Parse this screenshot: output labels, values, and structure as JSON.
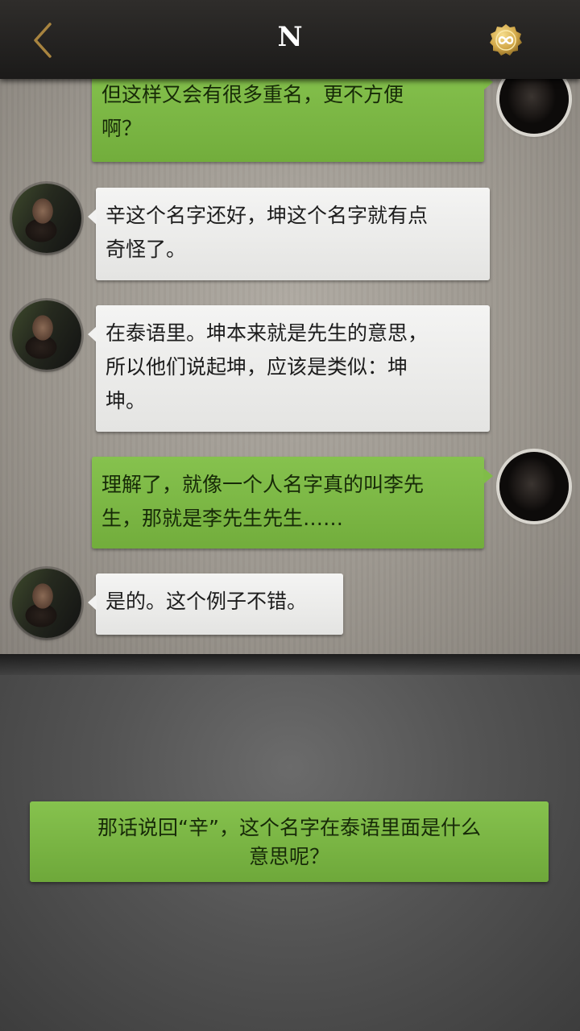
{
  "header": {
    "title": "N",
    "back_icon": "chevron-left-icon",
    "coin_icon": "infinity-coin-icon",
    "accent_color": "#c9a24a"
  },
  "messages": [
    {
      "side": "right",
      "lines": [
        "但这样又会有很多重名，更不方便",
        "啊？"
      ]
    },
    {
      "side": "left",
      "lines": [
        "辛这个名字还好，坤这个名字就有点",
        "奇怪了。"
      ]
    },
    {
      "side": "left",
      "lines": [
        "在泰语里。坤本来就是先生的意思，",
        "所以他们说起坤，应该是类似：坤",
        "坤。"
      ]
    },
    {
      "side": "right",
      "lines": [
        "理解了，就像一个人名字真的叫李先",
        "生，那就是李先生先生……"
      ]
    },
    {
      "side": "left",
      "lines": [
        "是的。这个例子不错。"
      ]
    }
  ],
  "reply_option": {
    "lines": [
      "那话说回“辛”，这个名字在泰语里面是什么",
      "意思呢？"
    ]
  }
}
